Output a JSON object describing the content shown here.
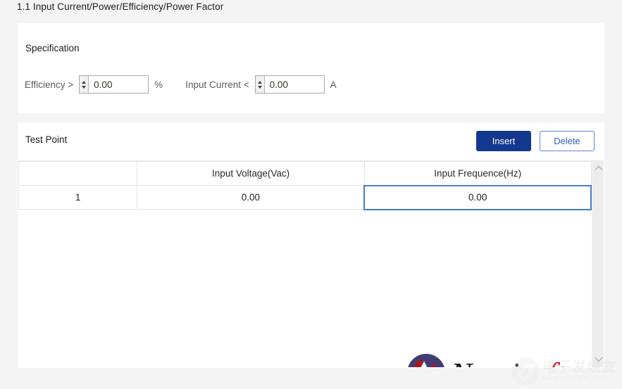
{
  "page": {
    "title": "1.1 Input Current/Power/Efficiency/Power Factor"
  },
  "specification": {
    "heading": "Specification",
    "efficiency": {
      "label": "Efficiency >",
      "value": "0.00",
      "placeholder": "0.00",
      "unit": "%",
      "spinner_up_icon": "triangle-up-icon",
      "spinner_down_icon": "triangle-down-icon"
    },
    "input_current": {
      "label": "Input Current <",
      "value": "0.00",
      "placeholder": "0.00",
      "unit": "A",
      "spinner_up_icon": "triangle-up-icon",
      "spinner_down_icon": "triangle-down-icon"
    }
  },
  "test_point": {
    "heading": "Test Point",
    "insert_label": "Insert",
    "delete_label": "Delete",
    "columns": [
      "",
      "Input Voltage(Vac)",
      "Input Frequence(Hz)"
    ],
    "rows": [
      {
        "index": "1",
        "input_voltage": "0.00",
        "input_frequence": "0.00"
      }
    ],
    "selected_cell": "input_frequence",
    "scrollbar": {
      "up_icon": "chevron-up-icon",
      "down_icon": "chevron-down-icon"
    }
  },
  "logo": {
    "word_first": "Nami",
    "word_second": "soft",
    "mark_icon": "namisoft-wave-icon"
  },
  "watermark": {
    "text_cn": "电子发烧友",
    "text_url": "www.elecfans.com",
    "badge_icon": "elecfans-badge-icon"
  },
  "colors": {
    "page_background": "#f4f4f4",
    "panel_background": "#ffffff",
    "primary_button": "#14388d",
    "secondary_button_text": "#2b5fc4",
    "secondary_button_border": "#5b86d8",
    "selected_cell_border": "#3f7fd0",
    "grid_border": "#e4e4e4",
    "label_text": "#5c5c5c",
    "value_text": "#3c3226",
    "logo_circle": "#413d73",
    "logo_red": "#b5121b",
    "logo_soft_red": "#cc1111"
  }
}
